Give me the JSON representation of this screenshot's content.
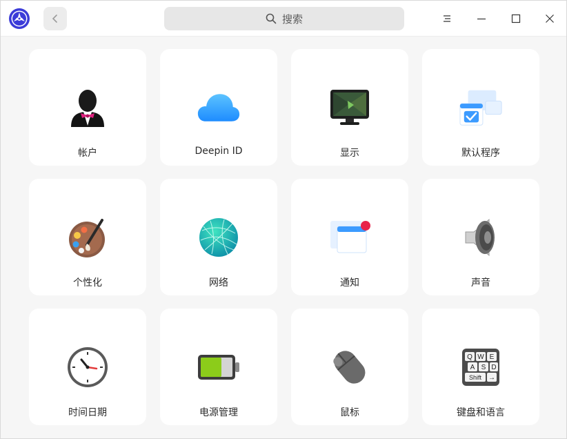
{
  "titlebar": {
    "search_placeholder": "搜索"
  },
  "modules": [
    {
      "label": "帐户",
      "icon": "account-icon"
    },
    {
      "label": "Deepin ID",
      "icon": "cloud-icon"
    },
    {
      "label": "显示",
      "icon": "display-icon"
    },
    {
      "label": "默认程序",
      "icon": "default-apps-icon"
    },
    {
      "label": "个性化",
      "icon": "palette-icon"
    },
    {
      "label": "网络",
      "icon": "network-globe-icon"
    },
    {
      "label": "通知",
      "icon": "notification-icon"
    },
    {
      "label": "声音",
      "icon": "speaker-icon"
    },
    {
      "label": "时间日期",
      "icon": "clock-icon"
    },
    {
      "label": "电源管理",
      "icon": "battery-icon"
    },
    {
      "label": "鼠标",
      "icon": "mouse-icon"
    },
    {
      "label": "键盘和语言",
      "icon": "keyboard-icon"
    }
  ],
  "keyboard_keys": {
    "row1": [
      "Q",
      "W",
      "E"
    ],
    "row2": [
      "A",
      "S",
      "D"
    ],
    "shift": "Shift",
    "arrow": "→"
  },
  "colors": {
    "accent": "#2fa4ff",
    "card_bg": "#ffffff",
    "window_bg": "#f6f6f6"
  }
}
